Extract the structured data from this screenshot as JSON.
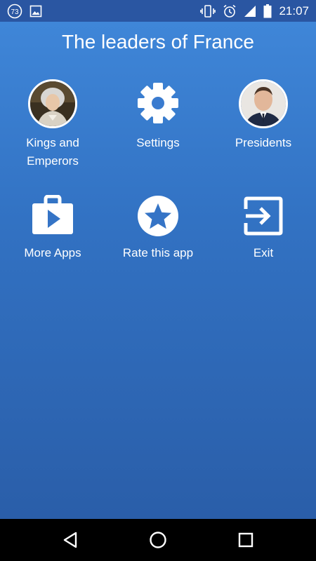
{
  "status_bar": {
    "notification_count": "73",
    "time": "21:07"
  },
  "app": {
    "title": "The leaders of France"
  },
  "menu": {
    "kings_label": "Kings and Emperors",
    "settings_label": "Settings",
    "presidents_label": "Presidents",
    "more_apps_label": "More Apps",
    "rate_label": "Rate this app",
    "exit_label": "Exit"
  },
  "colors": {
    "background_top": "#3f86d8",
    "background_bottom": "#2a5ea9",
    "status_bar": "#2a56a2",
    "nav_bar": "#000000",
    "icon_fill": "#ffffff"
  },
  "icons": [
    "notification-73-icon",
    "image-icon",
    "vibrate-icon",
    "alarm-icon",
    "signal-icon",
    "battery-icon",
    "gear-icon",
    "shopping-bag-play-icon",
    "star-circle-icon",
    "exit-icon",
    "back-icon",
    "home-icon",
    "recents-icon"
  ]
}
